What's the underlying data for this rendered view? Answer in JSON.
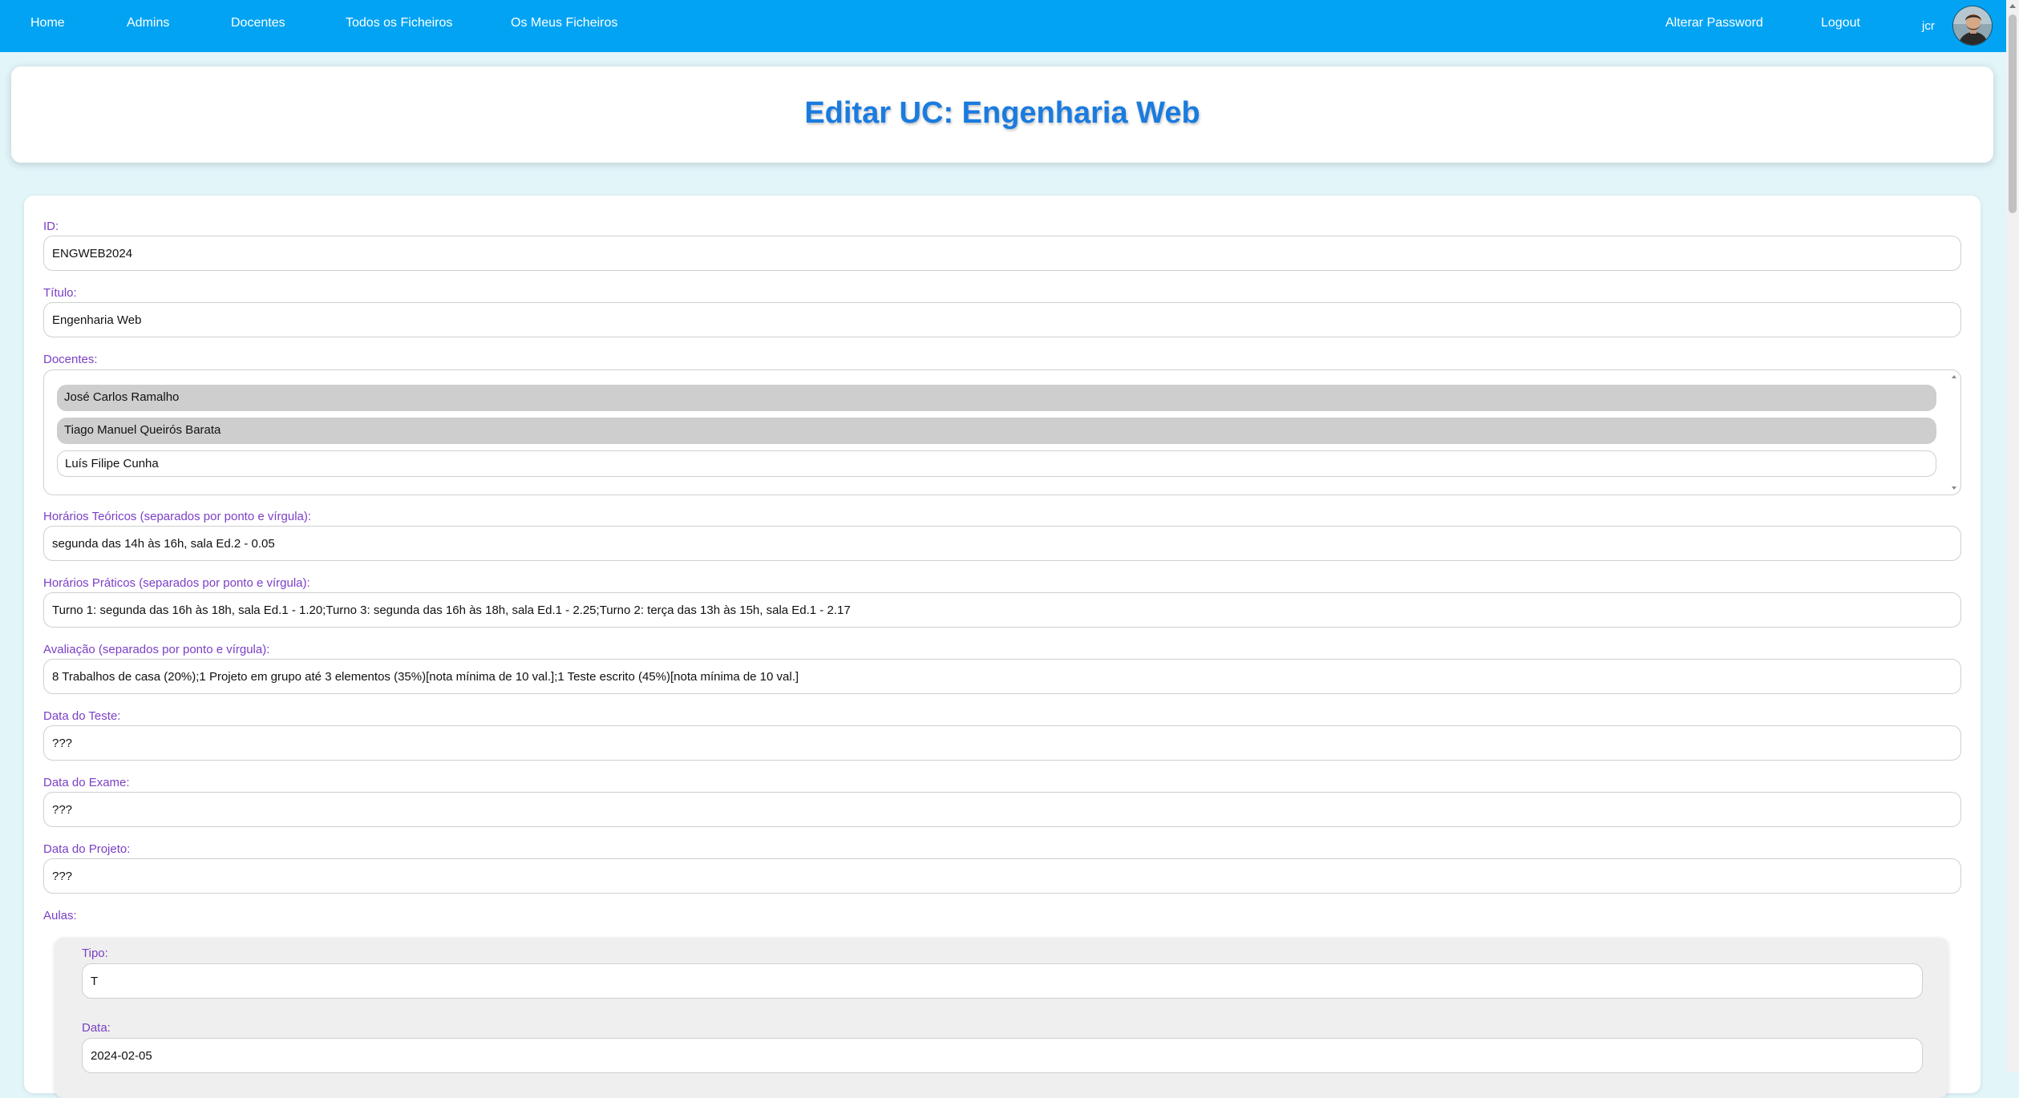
{
  "nav": {
    "home": "Home",
    "admins": "Admins",
    "docentes": "Docentes",
    "todos_ficheiros": "Todos os Ficheiros",
    "meus_ficheiros": "Os Meus Ficheiros",
    "alterar_password": "Alterar Password",
    "logout": "Logout",
    "username": "jcr"
  },
  "page_title": "Editar UC: Engenharia Web",
  "form": {
    "id": {
      "label": "ID:",
      "value": "ENGWEB2024"
    },
    "titulo": {
      "label": "Título:",
      "value": "Engenharia Web"
    },
    "docentes": {
      "label": "Docentes:",
      "options": [
        {
          "name": "José Carlos Ramalho",
          "selected": true
        },
        {
          "name": "Tiago Manuel Queirós Barata",
          "selected": true
        },
        {
          "name": "Luís Filipe Cunha",
          "selected": false
        }
      ]
    },
    "horarios_teoricos": {
      "label": "Horários Teóricos (separados por ponto e vírgula):",
      "value": "segunda das 14h às 16h, sala Ed.2 - 0.05"
    },
    "horarios_praticos": {
      "label": "Horários Práticos (separados por ponto e vírgula):",
      "value": "Turno 1: segunda das 16h às 18h, sala Ed.1 - 1.20;Turno 3: segunda das 16h às 18h, sala Ed.1 - 2.25;Turno 2: terça das 13h às 15h, sala Ed.1 - 2.17"
    },
    "avaliacao": {
      "label": "Avaliação (separados por ponto e vírgula):",
      "value": "8 Trabalhos de casa (20%);1 Projeto em grupo até 3 elementos (35%)[nota mínima de 10 val.];1 Teste escrito (45%)[nota mínima de 10 val.]"
    },
    "data_teste": {
      "label": "Data do Teste:",
      "value": "???"
    },
    "data_exame": {
      "label": "Data do Exame:",
      "value": "???"
    },
    "data_projeto": {
      "label": "Data do Projeto:",
      "value": "???"
    },
    "aulas": {
      "label": "Aulas:",
      "items": [
        {
          "tipo_label": "Tipo:",
          "tipo": "T",
          "data_label": "Data:",
          "data": "2024-02-05"
        }
      ]
    }
  },
  "colors": {
    "navbar": "#02a3f3",
    "title": "#1a7bdf",
    "label": "#7b3fc6",
    "background": "#e2f6f9"
  },
  "icons": {
    "avatar": "user-avatar"
  }
}
